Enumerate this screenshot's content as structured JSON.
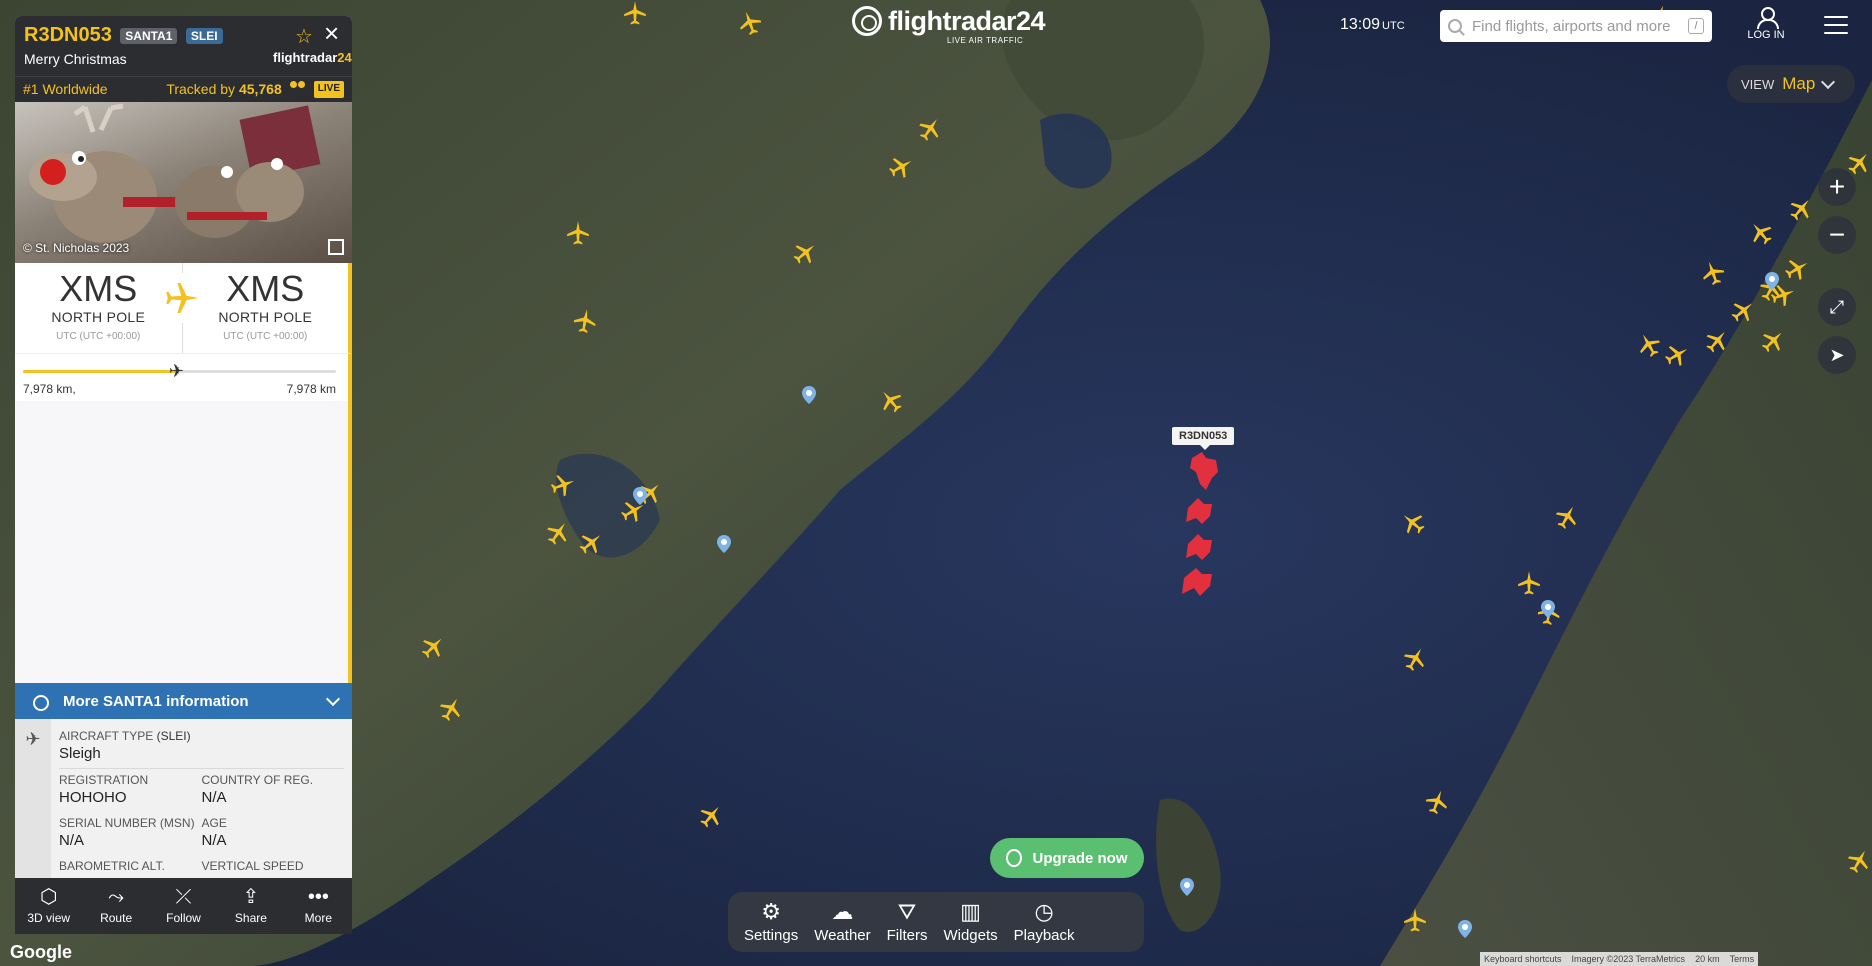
{
  "header": {
    "logo_text": "flightradar24",
    "logo_tagline": "LIVE AIR TRAFFIC",
    "time": "13:09",
    "time_zone": "UTC",
    "search_placeholder": "Find flights, airports and more",
    "search_shortcut": "/",
    "login_label": "LOG IN"
  },
  "view_toggle": {
    "label": "VIEW",
    "value": "Map"
  },
  "flight_panel": {
    "callsign": "R3DN053",
    "tag_1": "SANTA1",
    "tag_2": "SLEI",
    "name": "Merry Christmas",
    "brand_small": "flightradar",
    "brand_small_num": "24",
    "rank": "#1 Worldwide",
    "tracked_label": "Tracked by",
    "tracked_count": "45,768",
    "live_badge": "LIVE",
    "photo_credit": "© St. Nicholas 2023",
    "origin": {
      "code": "XMS",
      "name": "NORTH POLE",
      "tz": "UTC (UTC +00:00)"
    },
    "destination": {
      "code": "XMS",
      "name": "NORTH POLE",
      "tz": "UTC (UTC +00:00)"
    },
    "progress_fraction": 0.49,
    "distance_left": "7,978 km,",
    "distance_right": "7,978 km",
    "more_info_label": "More SANTA1 information",
    "details": {
      "aircraft_type_label": "AIRCRAFT TYPE",
      "aircraft_type_code": "(SLEI)",
      "aircraft_type_value": "Sleigh",
      "registration_label": "REGISTRATION",
      "registration_value": "HOHOHO",
      "country_label": "COUNTRY OF REG.",
      "country_value": "N/A",
      "serial_label": "SERIAL NUMBER (MSN)",
      "serial_value": "N/A",
      "age_label": "AGE",
      "age_value": "N/A",
      "baro_alt_label": "BAROMETRIC ALT.",
      "vertical_speed_label": "VERTICAL SPEED"
    },
    "footer": [
      {
        "label": "3D view",
        "icon": "cube-icon"
      },
      {
        "label": "Route",
        "icon": "route-icon"
      },
      {
        "label": "Follow",
        "icon": "follow-icon"
      },
      {
        "label": "Share",
        "icon": "share-icon"
      },
      {
        "label": "More",
        "icon": "more-icon"
      }
    ]
  },
  "map": {
    "selected_label": "R3DN053",
    "accent_color": "#f4c220",
    "santa_color": "#e2303f"
  },
  "upgrade_label": "Upgrade now",
  "bottom_bar": [
    {
      "label": "Settings",
      "icon": "gear-icon"
    },
    {
      "label": "Weather",
      "icon": "weather-icon"
    },
    {
      "label": "Filters",
      "icon": "filter-icon"
    },
    {
      "label": "Widgets",
      "icon": "widgets-icon"
    },
    {
      "label": "Playback",
      "icon": "history-icon"
    }
  ],
  "google_label": "Google",
  "attribution": {
    "shortcuts": "Keyboard shortcuts",
    "imagery": "Imagery ©2023 TerraMetrics",
    "scale": "20 km",
    "terms": "Terms"
  }
}
